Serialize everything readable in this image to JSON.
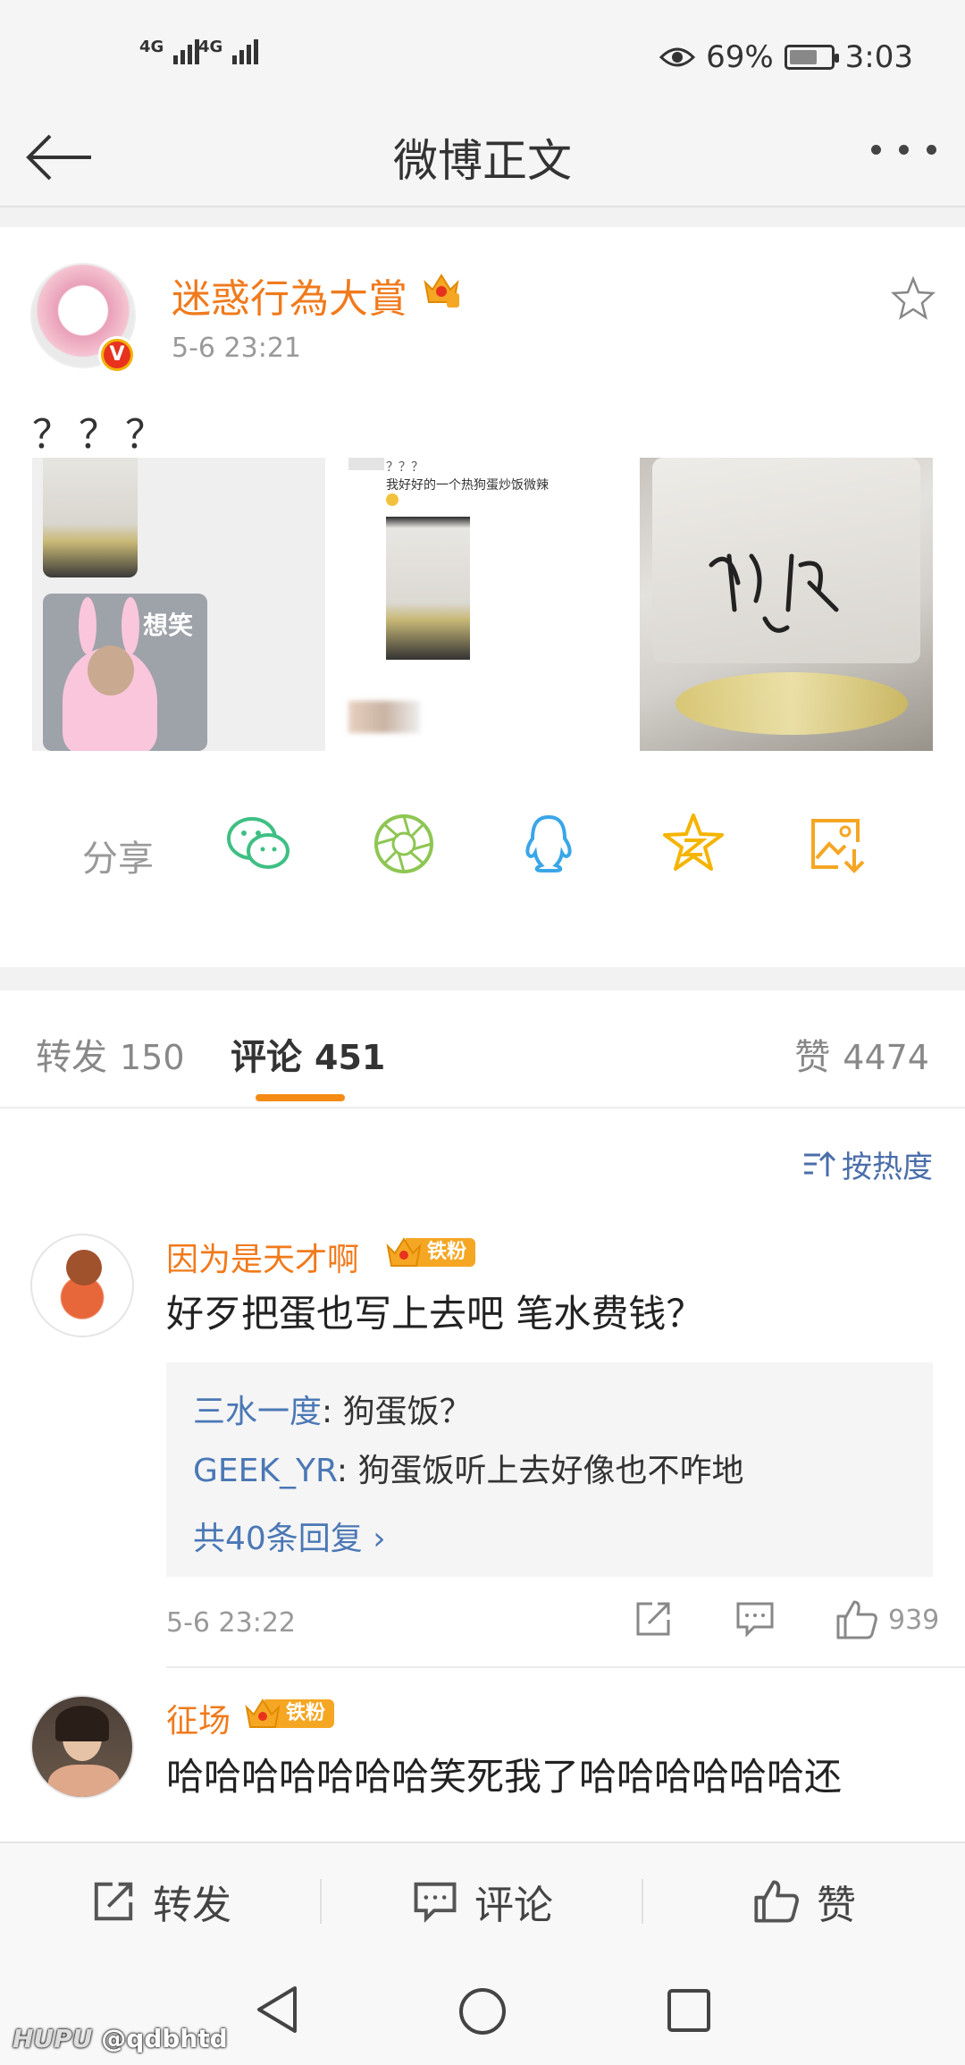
{
  "status_bar": {
    "signal1": "4G",
    "signal2": "4G",
    "battery_percent": "69%",
    "battery_level": 0.69,
    "time": "3:03"
  },
  "nav": {
    "title": "微博正文"
  },
  "post": {
    "author": "迷惑行為大賞",
    "time": "5-6 23:21",
    "text": "？？？",
    "image2_caption1": "？？？",
    "image2_caption2": "我好好的一个热狗蛋炒饭微辣",
    "sticker_text": "想笑",
    "share_label": "分享"
  },
  "tabs": [
    {
      "label": "转发",
      "count": "150"
    },
    {
      "label": "评论",
      "count": "451"
    },
    {
      "label": "赞",
      "count": "4474"
    }
  ],
  "sort_label": "按热度",
  "comments": [
    {
      "name": "因为是天才啊",
      "badge": "铁粉",
      "text": "好歹把蛋也写上去吧 笔水费钱？",
      "replies": [
        {
          "name": "三水一度",
          "text": ": 狗蛋饭？"
        },
        {
          "name": "GEEK_YR",
          "text": ": 狗蛋饭听上去好像也不咋地"
        }
      ],
      "more_replies": "共40条回复",
      "time": "5-6 23:22",
      "likes": "939"
    },
    {
      "name": "征场",
      "badge": "铁粉",
      "text": "哈哈哈哈哈哈哈笑死我了哈哈哈哈哈哈还"
    }
  ],
  "action_bar": {
    "repost": "转发",
    "comment": "评论",
    "like": "赞"
  },
  "watermark": {
    "brand": "HUPU",
    "handle": "@qdbhtd"
  },
  "colors": {
    "accent": "#f07a1c",
    "link": "#4b78b5",
    "tab_underline": "#f58b14"
  }
}
